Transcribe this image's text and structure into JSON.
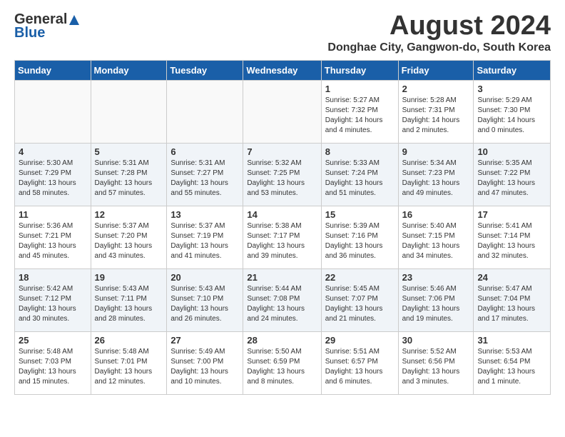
{
  "header": {
    "logo_general": "General",
    "logo_blue": "Blue",
    "month_year": "August 2024",
    "location": "Donghae City, Gangwon-do, South Korea"
  },
  "weekdays": [
    "Sunday",
    "Monday",
    "Tuesday",
    "Wednesday",
    "Thursday",
    "Friday",
    "Saturday"
  ],
  "weeks": [
    [
      {
        "day": "",
        "info": ""
      },
      {
        "day": "",
        "info": ""
      },
      {
        "day": "",
        "info": ""
      },
      {
        "day": "",
        "info": ""
      },
      {
        "day": "1",
        "info": "Sunrise: 5:27 AM\nSunset: 7:32 PM\nDaylight: 14 hours\nand 4 minutes."
      },
      {
        "day": "2",
        "info": "Sunrise: 5:28 AM\nSunset: 7:31 PM\nDaylight: 14 hours\nand 2 minutes."
      },
      {
        "day": "3",
        "info": "Sunrise: 5:29 AM\nSunset: 7:30 PM\nDaylight: 14 hours\nand 0 minutes."
      }
    ],
    [
      {
        "day": "4",
        "info": "Sunrise: 5:30 AM\nSunset: 7:29 PM\nDaylight: 13 hours\nand 58 minutes."
      },
      {
        "day": "5",
        "info": "Sunrise: 5:31 AM\nSunset: 7:28 PM\nDaylight: 13 hours\nand 57 minutes."
      },
      {
        "day": "6",
        "info": "Sunrise: 5:31 AM\nSunset: 7:27 PM\nDaylight: 13 hours\nand 55 minutes."
      },
      {
        "day": "7",
        "info": "Sunrise: 5:32 AM\nSunset: 7:25 PM\nDaylight: 13 hours\nand 53 minutes."
      },
      {
        "day": "8",
        "info": "Sunrise: 5:33 AM\nSunset: 7:24 PM\nDaylight: 13 hours\nand 51 minutes."
      },
      {
        "day": "9",
        "info": "Sunrise: 5:34 AM\nSunset: 7:23 PM\nDaylight: 13 hours\nand 49 minutes."
      },
      {
        "day": "10",
        "info": "Sunrise: 5:35 AM\nSunset: 7:22 PM\nDaylight: 13 hours\nand 47 minutes."
      }
    ],
    [
      {
        "day": "11",
        "info": "Sunrise: 5:36 AM\nSunset: 7:21 PM\nDaylight: 13 hours\nand 45 minutes."
      },
      {
        "day": "12",
        "info": "Sunrise: 5:37 AM\nSunset: 7:20 PM\nDaylight: 13 hours\nand 43 minutes."
      },
      {
        "day": "13",
        "info": "Sunrise: 5:37 AM\nSunset: 7:19 PM\nDaylight: 13 hours\nand 41 minutes."
      },
      {
        "day": "14",
        "info": "Sunrise: 5:38 AM\nSunset: 7:17 PM\nDaylight: 13 hours\nand 39 minutes."
      },
      {
        "day": "15",
        "info": "Sunrise: 5:39 AM\nSunset: 7:16 PM\nDaylight: 13 hours\nand 36 minutes."
      },
      {
        "day": "16",
        "info": "Sunrise: 5:40 AM\nSunset: 7:15 PM\nDaylight: 13 hours\nand 34 minutes."
      },
      {
        "day": "17",
        "info": "Sunrise: 5:41 AM\nSunset: 7:14 PM\nDaylight: 13 hours\nand 32 minutes."
      }
    ],
    [
      {
        "day": "18",
        "info": "Sunrise: 5:42 AM\nSunset: 7:12 PM\nDaylight: 13 hours\nand 30 minutes."
      },
      {
        "day": "19",
        "info": "Sunrise: 5:43 AM\nSunset: 7:11 PM\nDaylight: 13 hours\nand 28 minutes."
      },
      {
        "day": "20",
        "info": "Sunrise: 5:43 AM\nSunset: 7:10 PM\nDaylight: 13 hours\nand 26 minutes."
      },
      {
        "day": "21",
        "info": "Sunrise: 5:44 AM\nSunset: 7:08 PM\nDaylight: 13 hours\nand 24 minutes."
      },
      {
        "day": "22",
        "info": "Sunrise: 5:45 AM\nSunset: 7:07 PM\nDaylight: 13 hours\nand 21 minutes."
      },
      {
        "day": "23",
        "info": "Sunrise: 5:46 AM\nSunset: 7:06 PM\nDaylight: 13 hours\nand 19 minutes."
      },
      {
        "day": "24",
        "info": "Sunrise: 5:47 AM\nSunset: 7:04 PM\nDaylight: 13 hours\nand 17 minutes."
      }
    ],
    [
      {
        "day": "25",
        "info": "Sunrise: 5:48 AM\nSunset: 7:03 PM\nDaylight: 13 hours\nand 15 minutes."
      },
      {
        "day": "26",
        "info": "Sunrise: 5:48 AM\nSunset: 7:01 PM\nDaylight: 13 hours\nand 12 minutes."
      },
      {
        "day": "27",
        "info": "Sunrise: 5:49 AM\nSunset: 7:00 PM\nDaylight: 13 hours\nand 10 minutes."
      },
      {
        "day": "28",
        "info": "Sunrise: 5:50 AM\nSunset: 6:59 PM\nDaylight: 13 hours\nand 8 minutes."
      },
      {
        "day": "29",
        "info": "Sunrise: 5:51 AM\nSunset: 6:57 PM\nDaylight: 13 hours\nand 6 minutes."
      },
      {
        "day": "30",
        "info": "Sunrise: 5:52 AM\nSunset: 6:56 PM\nDaylight: 13 hours\nand 3 minutes."
      },
      {
        "day": "31",
        "info": "Sunrise: 5:53 AM\nSunset: 6:54 PM\nDaylight: 13 hours\nand 1 minute."
      }
    ]
  ]
}
